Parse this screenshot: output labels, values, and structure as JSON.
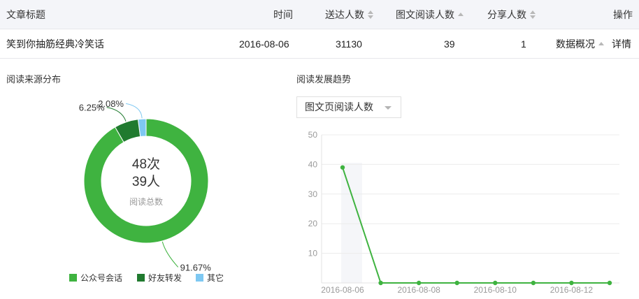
{
  "table": {
    "headers": {
      "title": "文章标题",
      "time": "时间",
      "delivered": "送达人数",
      "readers": "图文阅读人数",
      "shares": "分享人数",
      "actions": "操作"
    },
    "row": {
      "title": "笑到你抽筋经典冷笑话",
      "time": "2016-08-06",
      "delivered": "31130",
      "readers": "39",
      "shares": "1",
      "overview_link": "数据概况",
      "detail_link": "详情"
    }
  },
  "source_panel": {
    "title": "阅读来源分布",
    "center_count": "48次",
    "center_people": "39人",
    "center_caption": "阅读总数"
  },
  "trend_panel": {
    "title": "阅读发展趋势",
    "metric_select": "图文页阅读人数"
  },
  "colors": {
    "green": "#3fb340",
    "dark_green": "#207a2f",
    "light_blue": "#7ec8f2",
    "link": "#459ae9"
  },
  "chart_data": [
    {
      "type": "pie",
      "variant": "donut",
      "slices": [
        {
          "name": "公众号会话",
          "value": 91.67,
          "label": "91.67%",
          "color": "#3fb340"
        },
        {
          "name": "好友转发",
          "value": 6.25,
          "label": "6.25%",
          "color": "#207a2f"
        },
        {
          "name": "其它",
          "value": 2.08,
          "label": "2.08%",
          "color": "#7ec8f2"
        }
      ],
      "legend_placement": "bottom"
    },
    {
      "type": "line",
      "x": [
        "2016-08-06",
        "2016-08-07",
        "2016-08-08",
        "2016-08-09",
        "2016-08-10",
        "2016-08-11",
        "2016-08-12",
        "2016-08-13"
      ],
      "x_tick_labels": [
        "2016-08-06",
        "2016-08-08",
        "2016-08-10",
        "2016-08-12"
      ],
      "series": [
        {
          "values": [
            39,
            0,
            0,
            0,
            0,
            0,
            0,
            0
          ],
          "color": "#3fb340"
        }
      ],
      "y_ticks": [
        10,
        20,
        30,
        40,
        50
      ],
      "ylim": [
        0,
        50
      ],
      "grid": true
    }
  ]
}
